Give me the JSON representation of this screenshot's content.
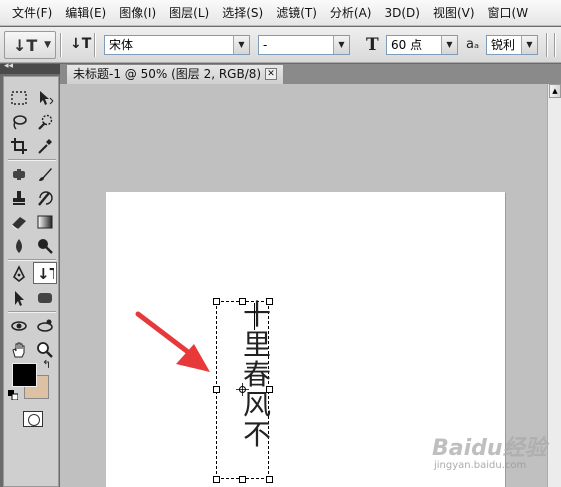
{
  "menubar": {
    "items": [
      "文件(F)",
      "编辑(E)",
      "图像(I)",
      "图层(L)",
      "选择(S)",
      "滤镜(T)",
      "分析(A)",
      "3D(D)",
      "视图(V)",
      "窗口(W"
    ]
  },
  "options": {
    "tool_preset_glyph": "↓T",
    "orientation_glyph": "↓T",
    "font_family": "宋体",
    "font_style": "-",
    "font_size": "60 点",
    "antialias_label": "aₐ",
    "antialias": "锐利"
  },
  "document": {
    "tab_title": "未标题-1 @ 50% (图层 2, RGB/8) *",
    "close_glyph": "✕"
  },
  "canvas_text": [
    "十",
    "里",
    "春",
    "风",
    "不"
  ],
  "colors": {
    "foreground": "#000000",
    "background": "#dcc1a5",
    "arrow": "#e8393a"
  },
  "watermark": {
    "brand": "Baidu经验",
    "url": "jingyan.baidu.com"
  }
}
